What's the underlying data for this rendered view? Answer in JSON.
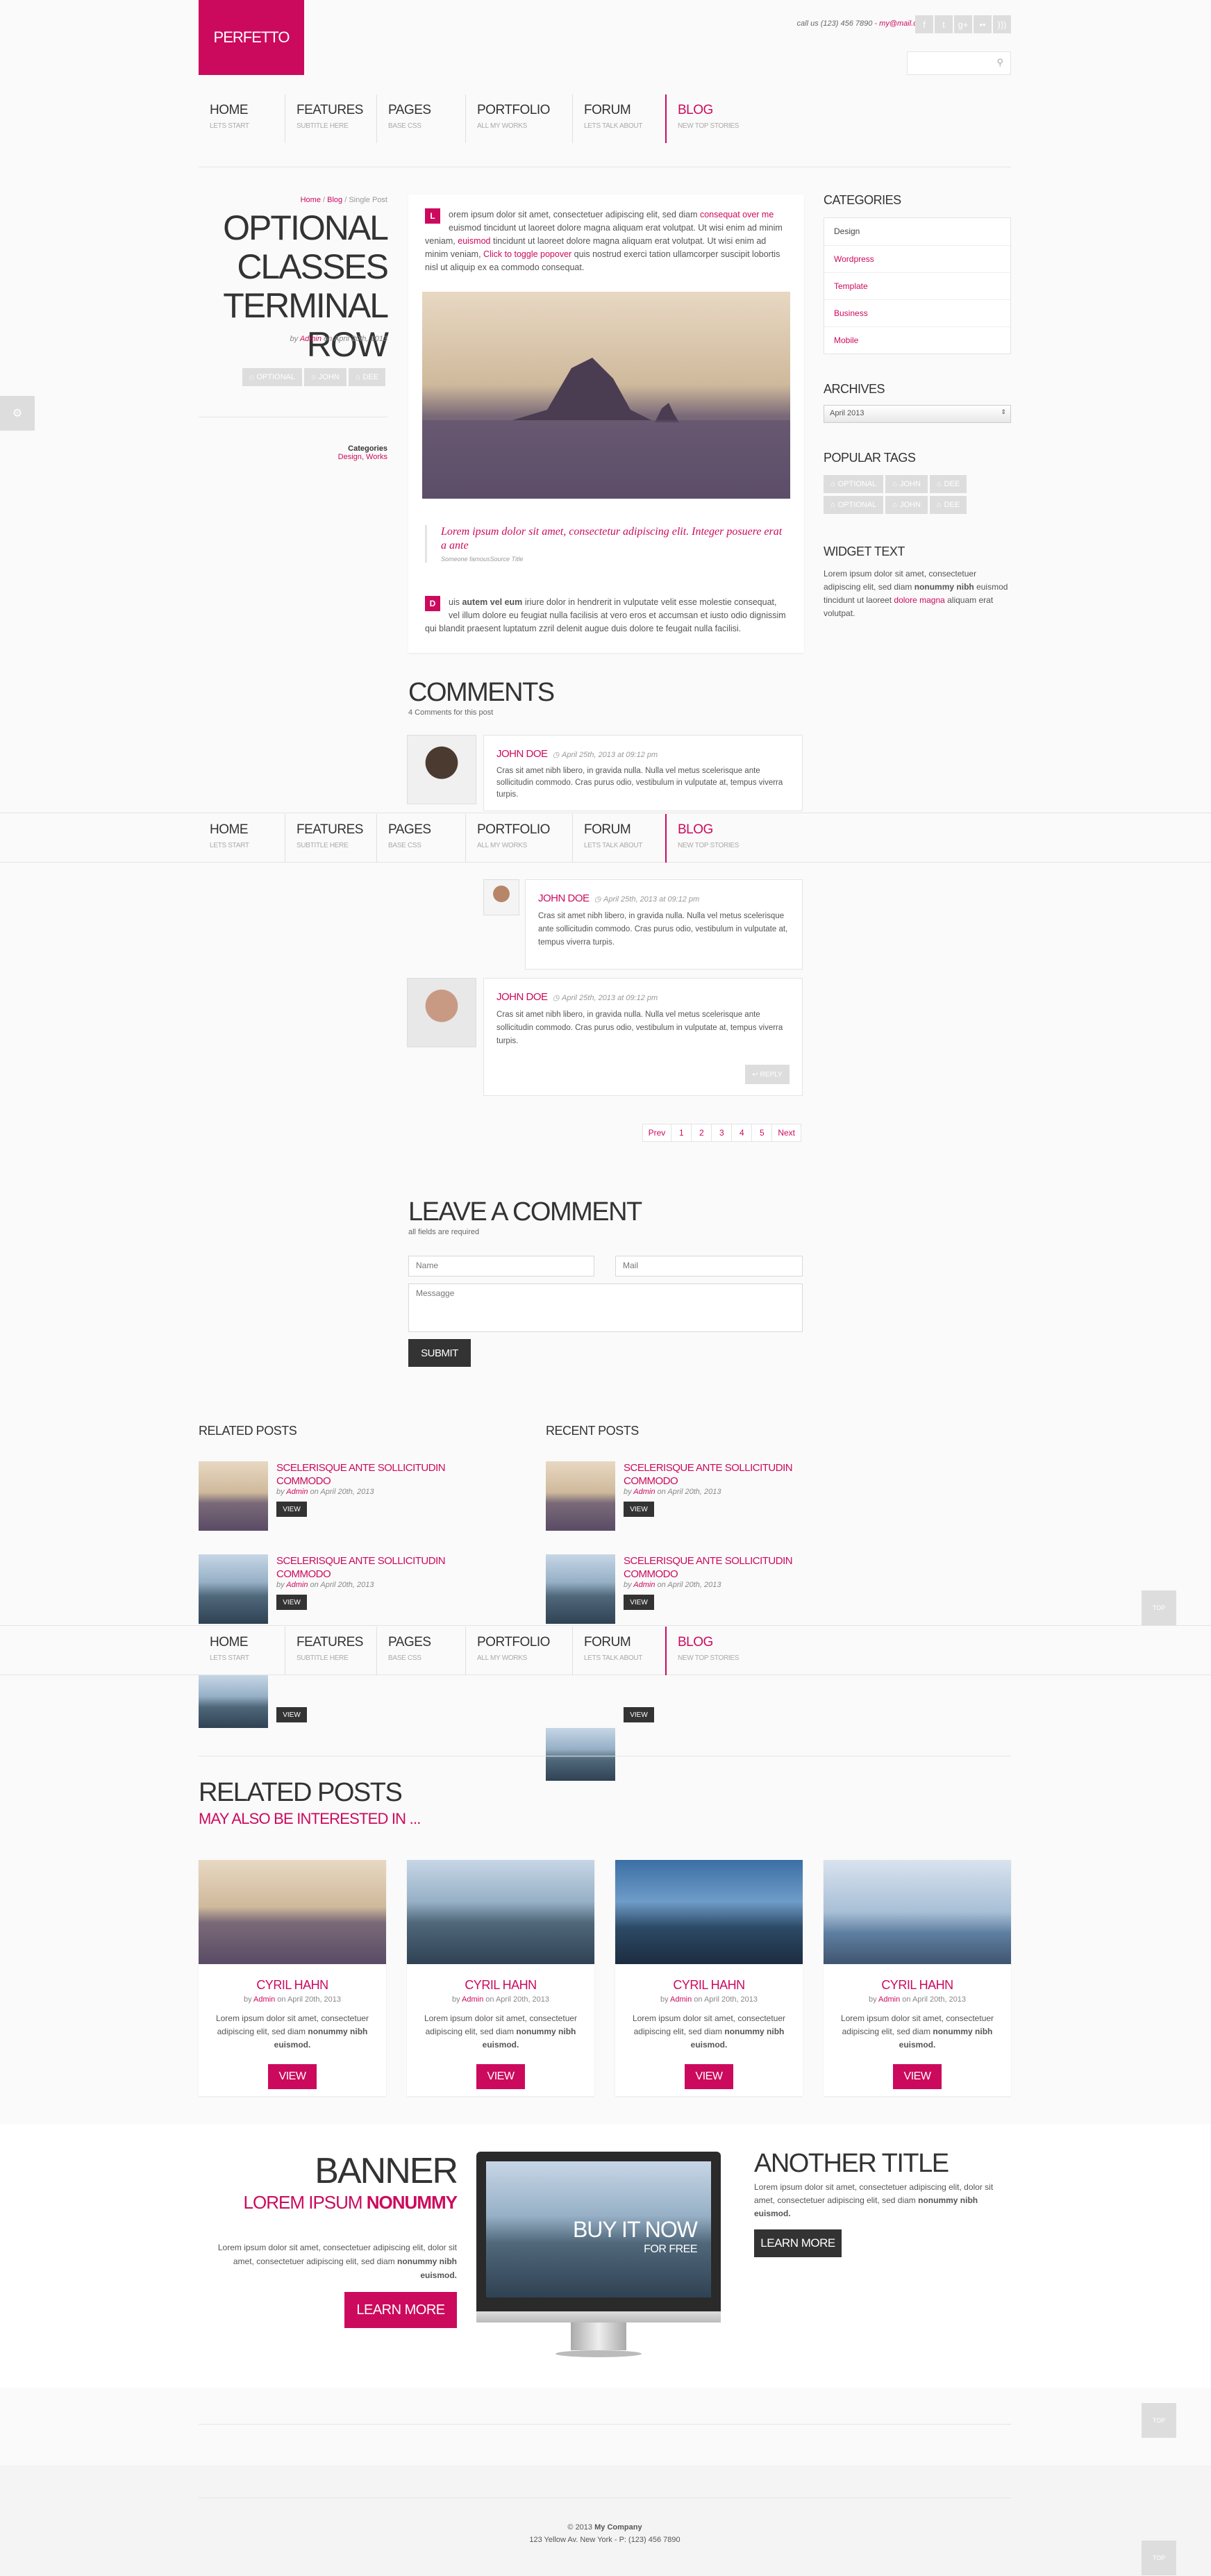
{
  "header": {
    "logo": "PERFETTO",
    "contact_prefix": "call us (123) 456 7890 - ",
    "contact_email": "my@mail.com",
    "social": [
      {
        "icon": "facebook-icon",
        "glyph": "f"
      },
      {
        "icon": "twitter-icon",
        "glyph": "t"
      },
      {
        "icon": "googleplus-icon",
        "glyph": "g+"
      },
      {
        "icon": "flickr-icon",
        "glyph": "••"
      },
      {
        "icon": "rss-icon",
        "glyph": ")))"
      }
    ],
    "search_placeholder": ""
  },
  "nav": [
    {
      "label": "HOME",
      "sub": "LETS START"
    },
    {
      "label": "FEATURES",
      "sub": "SUBTITLE HERE"
    },
    {
      "label": "PAGES",
      "sub": "BASE CSS"
    },
    {
      "label": "PORTFOLIO",
      "sub": "ALL MY WORKS"
    },
    {
      "label": "FORUM",
      "sub": "LETS TALK ABOUT"
    },
    {
      "label": "BLOG",
      "sub": "NEW TOP STORIES"
    }
  ],
  "breadcrumb": {
    "home": "Home",
    "blog": "Blog",
    "current": "Single Post",
    "sep": "/"
  },
  "post": {
    "title_1": "OPTIONAL",
    "title_2": "CLASSES",
    "title_3": "TERMINAL ROW",
    "by": "by ",
    "author": "Admin",
    "date": " on April 20th, 2013",
    "tags": [
      "OPTIONAL",
      "JOHN",
      "DEE"
    ],
    "categories_label": "Categories",
    "categories": "Design, Works",
    "para1_cap": "L",
    "para1_a": "orem ipsum dolor sit amet, consectetuer adipiscing elit, sed diam ",
    "para1_link1": "consequat over me",
    "para1_b": " euismod tincidunt ut laoreet dolore magna aliquam erat volutpat. Ut wisi enim ad minim veniam, ",
    "para1_link2": "euismod",
    "para1_c": " tincidunt ut laoreet dolore magna aliquam erat volutpat. Ut wisi enim ad minim veniam, ",
    "para1_link3": "Click to toggle popover",
    "para1_d": " quis nostrud exerci tation ullamcorper suscipit lobortis nisl ut aliquip ex ea commodo consequat.",
    "quote": "Lorem ipsum dolor sit amet, consectetur adipiscing elit. Integer posuere erat a ante",
    "quote_source": "Someone famousSource Title",
    "para2_cap": "D",
    "para2_a": "uis ",
    "para2_bold": "autem vel eum",
    "para2_b": " iriure dolor in hendrerit in vulputate velit esse molestie consequat, vel illum dolore eu feugiat nulla facilisis at vero eros et accumsan et iusto odio dignissim qui blandit praesent luptatum zzril delenit augue duis dolore te feugait nulla facilisi."
  },
  "comments": {
    "title": "COMMENTS",
    "count": "4 Comments for this post",
    "items": [
      {
        "name": "JOHN DOE",
        "date": "April 25th, 2013 at 09:12 pm",
        "text": "Cras sit amet nibh libero, in gravida nulla. Nulla vel metus scelerisque ante sollicitudin commodo. Cras purus odio, vestibulum in vulputate at, tempus viverra turpis."
      },
      {
        "name": "JOHN DOE",
        "date": "April 25th, 2013 at 09:12 pm",
        "text": "Cras sit amet nibh libero, in gravida nulla. Nulla vel metus scelerisque ante sollicitudin commodo. Cras purus odio, vestibulum in vulputate at, tempus viverra turpis."
      },
      {
        "name": "JOHN DOE",
        "date": "April 25th, 2013 at 09:12 pm",
        "text": "Cras sit amet nibh libero, in gravida nulla. Nulla vel metus scelerisque ante sollicitudin commodo. Cras purus odio, vestibulum in vulputate at, tempus viverra turpis."
      }
    ],
    "reply": "REPLY"
  },
  "pagination": [
    "Prev",
    "1",
    "2",
    "3",
    "4",
    "5",
    "Next"
  ],
  "leave": {
    "title": "LEAVE A COMMENT",
    "note": "all fields are required",
    "name": "Name",
    "mail": "Mail",
    "message": "Messagge",
    "submit": "SUBMIT"
  },
  "sidebar": {
    "categories_title": "CATEGORIES",
    "categories": [
      "Design",
      "Wordpress",
      "Template",
      "Business",
      "Mobile"
    ],
    "archives_title": "ARCHIVES",
    "archive_value": "April 2013",
    "tags_title": "POPULAR TAGS",
    "tags": [
      "OPTIONAL",
      "JOHN",
      "DEE",
      "OPTIONAL",
      "JOHN",
      "DEE"
    ],
    "widget_title": "WIDGET TEXT",
    "widget_a": "Lorem ipsum dolor sit amet, consectetuer adipiscing elit, sed diam ",
    "widget_bold": "nonummy nibh",
    "widget_b": " euismod tincidunt ut laoreet ",
    "widget_link": "dolore magna",
    "widget_c": " aliquam erat volutpat."
  },
  "related_small": {
    "title": "RELATED POSTS",
    "item_title": "SCELERISQUE ANTE SOLLICITUDIN COMMODO",
    "by": "by ",
    "author": "Admin",
    "date": " on April 20th, 2013",
    "view": "VIEW"
  },
  "recent_small": {
    "title": "RECENT POSTS"
  },
  "related_big": {
    "title": "RELATED POSTS",
    "subtitle": "MAY ALSO BE INTERESTED IN ...",
    "cards": [
      {
        "name": "CYRIL HAHN"
      },
      {
        "name": "CYRIL HAHN"
      },
      {
        "name": "CYRIL HAHN"
      },
      {
        "name": "CYRIL HAHN"
      }
    ],
    "by": "by ",
    "author": "Admin",
    "date": " on April 20th, 2013",
    "text_a": "Lorem ipsum dolor sit amet, consectetuer adipiscing elit, sed diam ",
    "text_bold": "nonummy nibh euismod.",
    "view": "VIEW"
  },
  "banner": {
    "title": "BANNER",
    "sub_a": "LOREM IPSUM ",
    "sub_b": "NONUMMY",
    "text_a": "Lorem ipsum dolor sit amet, consectetuer adipiscing elit, dolor sit amet, consectetuer adipiscing elit, sed diam ",
    "text_bold": "nonummy nibh euismod.",
    "button": "LEARN MORE",
    "screen_title": "BUY IT NOW",
    "screen_sub": "FOR FREE",
    "another_title": "ANOTHER TITLE",
    "another_a": "Lorem ipsum dolor sit amet, consectetuer adipiscing elit, dolor sit amet, consectetuer adipiscing elit, sed diam ",
    "another_bold": "nonummy nibh euismod.",
    "another_button": "LEARN MORE"
  },
  "footer": {
    "copy": "© 2013 ",
    "company": "My Company",
    "address": "123 Yellow Av. New York - P: (123) 456 7890"
  },
  "misc": {
    "top": "TOP",
    "gear": "⚙"
  },
  "colors": {
    "accent": "#cc0a5d",
    "dark": "#333333"
  }
}
